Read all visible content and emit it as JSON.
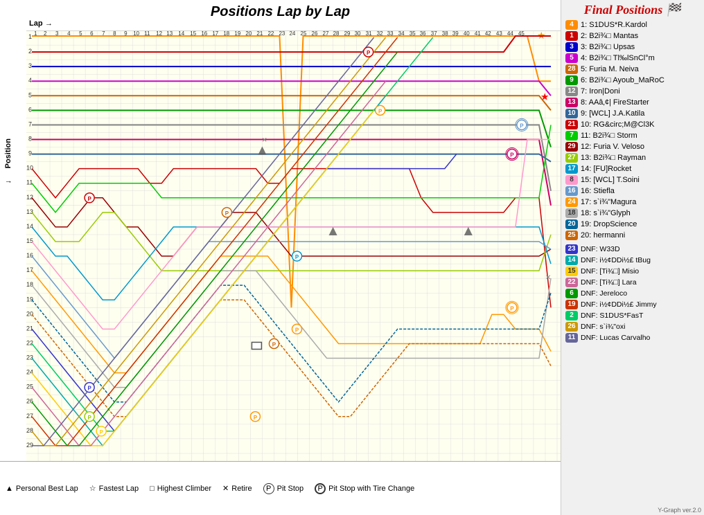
{
  "title": "Positions Lap by Lap",
  "labels": {
    "lap": "Lap",
    "position": "Position",
    "finalPositions": "Final Positions",
    "version": "Y-Graph ver.2.0"
  },
  "laps": [
    "1",
    "2",
    "3",
    "4",
    "5",
    "6",
    "7",
    "8",
    "9",
    "10",
    "11",
    "12",
    "13",
    "14",
    "15",
    "16",
    "17",
    "18",
    "19",
    "20",
    "21",
    "22",
    "23",
    "24",
    "25",
    "26",
    "27",
    "28",
    "29",
    "30",
    "31",
    "32",
    "33",
    "34",
    "35",
    "36",
    "37",
    "38",
    "39",
    "40",
    "41",
    "42",
    "43",
    "44",
    "45"
  ],
  "positions": [
    "1",
    "2",
    "3",
    "4",
    "5",
    "6",
    "7",
    "8",
    "9",
    "10",
    "11",
    "12",
    "13",
    "14",
    "15",
    "16",
    "17",
    "18",
    "19",
    "20",
    "21",
    "22",
    "23",
    "24",
    "25",
    "26",
    "27",
    "28",
    "29"
  ],
  "finalPositions": [
    {
      "pos": "4",
      "color": "#ff8c00",
      "label": "1: S1DUS*R.Kardol"
    },
    {
      "pos": "1",
      "color": "#cc0000",
      "label": "2: B2i¾□ Mantas"
    },
    {
      "pos": "3",
      "color": "#0000cc",
      "label": "3: B2i¾□ Upsas"
    },
    {
      "pos": "5",
      "color": "#cc00cc",
      "label": "4: B2i¾□ Tl‰lSnCl°m"
    },
    {
      "pos": "28",
      "color": "#cc6600",
      "label": "5: Furia M. Neiva"
    },
    {
      "pos": "9",
      "color": "#009900",
      "label": "6: B2i¾□ Ayoub_MaRoC"
    },
    {
      "pos": "12",
      "color": "#666666",
      "label": "7: Iron|Doni"
    },
    {
      "pos": "13",
      "color": "#cc0066",
      "label": "8: AAâ‚¢| FireStarter"
    },
    {
      "pos": "10",
      "color": "#336699",
      "label": "9: [WCL] J.A.Katila"
    },
    {
      "pos": "21",
      "color": "#cc0000",
      "label": "10: RG&circ;M@Cl3K"
    },
    {
      "pos": "7",
      "color": "#00cc00",
      "label": "11: B2i¾□ Storm"
    },
    {
      "pos": "29",
      "color": "#cc0000",
      "label": "12: Furia V. Veloso"
    },
    {
      "pos": "27",
      "color": "#99cc00",
      "label": "13: B2i¾□ Rayman"
    },
    {
      "pos": "17",
      "color": "#0099cc",
      "label": "14: [FU]Rocket"
    },
    {
      "pos": "8",
      "color": "#ff99cc",
      "label": "15: [WCL] T.Soini"
    },
    {
      "pos": "16",
      "color": "#6699cc",
      "label": "16: Stiefla"
    },
    {
      "pos": "24",
      "color": "#ff9900",
      "label": "17: s`i¾\"Magura"
    },
    {
      "pos": "18",
      "color": "#aaaaaa",
      "label": "18: s`i¾\"Glyph"
    },
    {
      "pos": "20",
      "color": "#006699",
      "label": "19: DropScience"
    },
    {
      "pos": "25",
      "color": "#cc6600",
      "label": "20: hermanni"
    }
  ],
  "dnfEntries": [
    {
      "pos": "23",
      "color": "#3333cc",
      "label": "DNF: W33D"
    },
    {
      "pos": "14",
      "color": "#00aaaa",
      "label": "DNF: i½¢DDi½£ tBug"
    },
    {
      "pos": "15",
      "color": "#ffcc00",
      "label": "DNF: [Ti¾□] Misio"
    },
    {
      "pos": "22",
      "color": "#cc6699",
      "label": "DNF: [Ti¾□] Lara"
    },
    {
      "pos": "6",
      "color": "#009900",
      "label": "DNF: Jereloco"
    },
    {
      "pos": "19",
      "color": "#cc3300",
      "label": "DNF: i½¢DDi½£ Jimmy"
    },
    {
      "pos": "2",
      "color": "#00cc66",
      "label": "DNF: S1DUS*FasT"
    },
    {
      "pos": "26",
      "color": "#cc9900",
      "label": "DNF: s`i¾\"oxi"
    },
    {
      "pos": "11",
      "color": "#666699",
      "label": "DNF: Lucas Carvalho"
    }
  ],
  "legend": [
    {
      "icon": "▲",
      "label": "Personal Best Lap"
    },
    {
      "icon": "☆",
      "label": "Fastest Lap"
    },
    {
      "icon": "□",
      "label": "Highest Climber"
    },
    {
      "icon": "✕",
      "label": "Retire"
    },
    {
      "icon": "Ⓟ",
      "label": "Pit Stop"
    },
    {
      "icon": "Ⓟ",
      "label": "Pit Stop with Tire Change"
    }
  ]
}
